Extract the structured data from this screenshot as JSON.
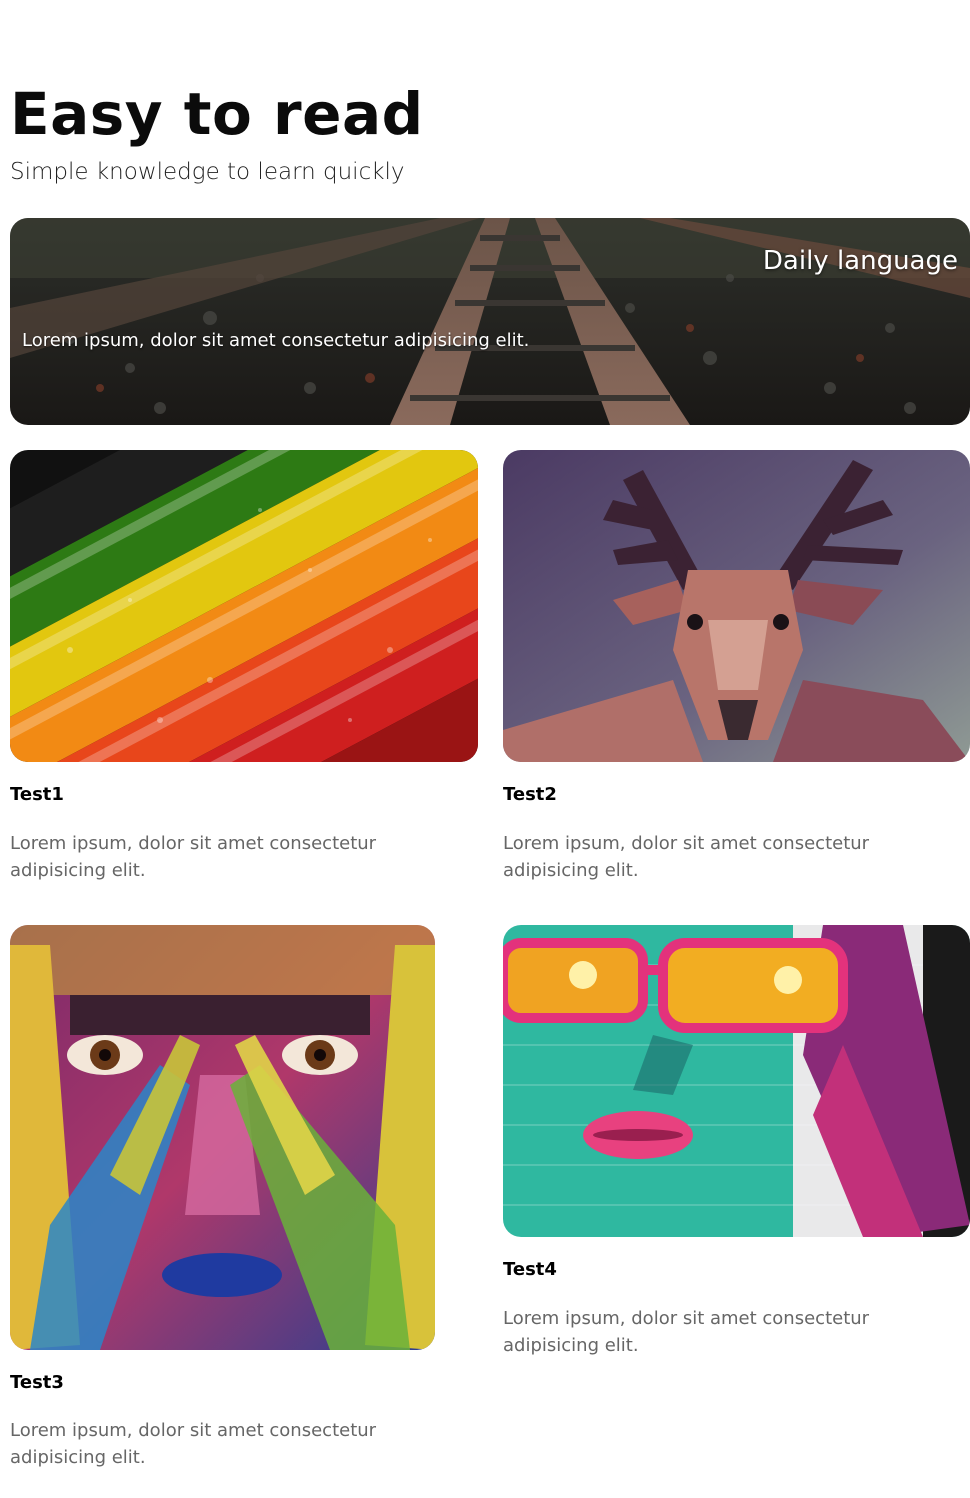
{
  "header": {
    "title": "Easy to read",
    "subtitle": "Simple knowledge to learn quickly"
  },
  "hero": {
    "title": "Daily language",
    "text": "Lorem ipsum, dolor sit amet consectetur adipisicing elit.",
    "image": "railway-tracks-photo"
  },
  "cards": [
    {
      "title": "Test1",
      "text": "Lorem ipsum, dolor sit amet consectetur adipisicing elit.",
      "image": "colored-pencils-photo"
    },
    {
      "title": "Test2",
      "text": "Lorem ipsum, dolor sit amet consectetur adipisicing elit.",
      "image": "low-poly-deer-art"
    },
    {
      "title": "Test3",
      "text": "Lorem ipsum, dolor sit amet consectetur adipisicing elit.",
      "image": "painted-face-photo"
    },
    {
      "title": "Test4",
      "text": "Lorem ipsum, dolor sit amet consectetur adipisicing elit.",
      "image": "graffiti-woman-sunglasses"
    }
  ]
}
